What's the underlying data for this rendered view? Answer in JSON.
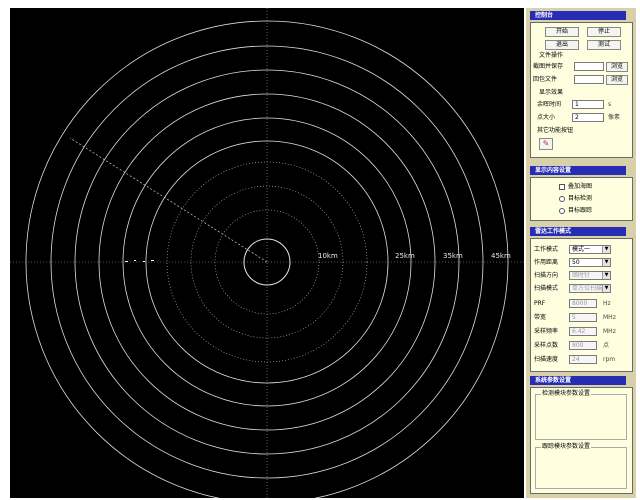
{
  "radar": {
    "range_labels": [
      "10km",
      "25km",
      "35km",
      "45km"
    ]
  },
  "control_panel": {
    "title": "控制台",
    "start_label": "开始",
    "stop_label": "停止",
    "exit_label": "退出",
    "test_label": "测试",
    "file_ops": {
      "label": "文件操作",
      "screenshot_save_label": "截图并保存",
      "packet_file_label": "回包文件",
      "browse_label": "浏览"
    },
    "display_effects": {
      "label": "显示效果",
      "afterglow_label": "余晖时间",
      "afterglow_value": "1",
      "afterglow_unit": "s",
      "dot_size_label": "点大小",
      "dot_size_value": "2",
      "dot_size_unit": "像素"
    },
    "other_functions_label": "其它功能按钮"
  },
  "display_settings": {
    "title": "显示内容设置",
    "overlay_map_label": "叠加海图",
    "target_detection_label": "目标检测",
    "target_tracking_label": "目标跟踪"
  },
  "radar_params": {
    "title": "雷达工作模式",
    "work_mode_label": "工作模式",
    "work_mode_value": "模式一",
    "range_label": "作用距离",
    "range_value": "50",
    "scan_direction_label": "扫描方向",
    "scan_direction_value": "顺时针",
    "scan_mode_label": "扫描模式",
    "scan_mode_value": "单方位扫描",
    "prf_label": "PRF",
    "prf_value": "8000",
    "prf_unit": "Hz",
    "bandwidth_label": "带宽",
    "bandwidth_value": "5",
    "bandwidth_unit": "MHz",
    "sample_freq_label": "采样频率",
    "sample_freq_value": "6.42",
    "sample_freq_unit": "MHz",
    "sample_points_label": "采样点数",
    "sample_points_value": "800",
    "sample_points_unit": "点",
    "scan_speed_label": "扫描速度",
    "scan_speed_value": "24",
    "scan_speed_unit": "rpm"
  },
  "system_params": {
    "title": "系统参数设置",
    "detection_group_label": "检测模块参数设置",
    "tracking_group_label": "跟踪模块参数设置"
  }
}
